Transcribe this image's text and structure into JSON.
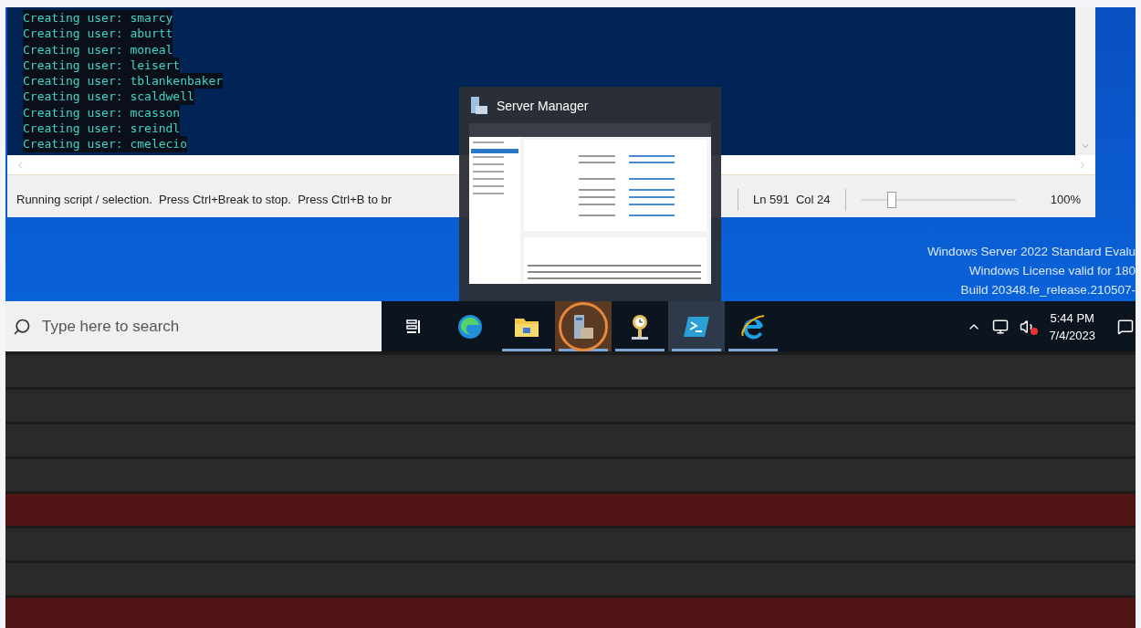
{
  "console": {
    "lines": [
      "Creating user: smarcy",
      "Creating user: aburtt",
      "Creating user: moneal",
      "Creating user: leisert",
      "Creating user: tblankenbaker",
      "Creating user: scaldwell",
      "Creating user: mcasson",
      "Creating user: sreindl",
      "Creating user: cmelecio"
    ]
  },
  "status_bar": {
    "message": "Running script / selection.  Press Ctrl+Break to stop.  Press Ctrl+B to br",
    "position": "Ln 591  Col 24",
    "zoom": {
      "level": 0.2
    },
    "zoom_reading": "100%"
  },
  "preview": {
    "title": "Server Manager"
  },
  "watermark": [
    "Windows Server 2022 Standard Evalu",
    "Windows License valid for 180",
    "Build 20348.fe_release.210507-"
  ],
  "taskbar": {
    "search": {
      "placeholder": "Type here to search"
    },
    "apps": [
      {
        "kind": "taskview",
        "running": false,
        "active": false,
        "hovered": false
      },
      {
        "kind": "edge",
        "running": false,
        "active": false,
        "hovered": false
      },
      {
        "kind": "explorer",
        "running": true,
        "active": false,
        "hovered": false
      },
      {
        "kind": "servermanager",
        "running": true,
        "active": false,
        "hovered": true
      },
      {
        "kind": "tools",
        "running": true,
        "active": false,
        "hovered": false
      },
      {
        "kind": "powershell",
        "running": true,
        "active": true,
        "hovered": false
      },
      {
        "kind": "ie",
        "running": true,
        "active": false,
        "hovered": false
      }
    ],
    "time": "5:44 PM",
    "date": "7/4/2023"
  },
  "bands": [
    {
      "highlighted": false
    },
    {
      "highlighted": false
    },
    {
      "highlighted": false
    },
    {
      "highlighted": false
    },
    {
      "highlighted": true
    },
    {
      "highlighted": false
    },
    {
      "highlighted": false
    },
    {
      "highlighted": true
    }
  ]
}
